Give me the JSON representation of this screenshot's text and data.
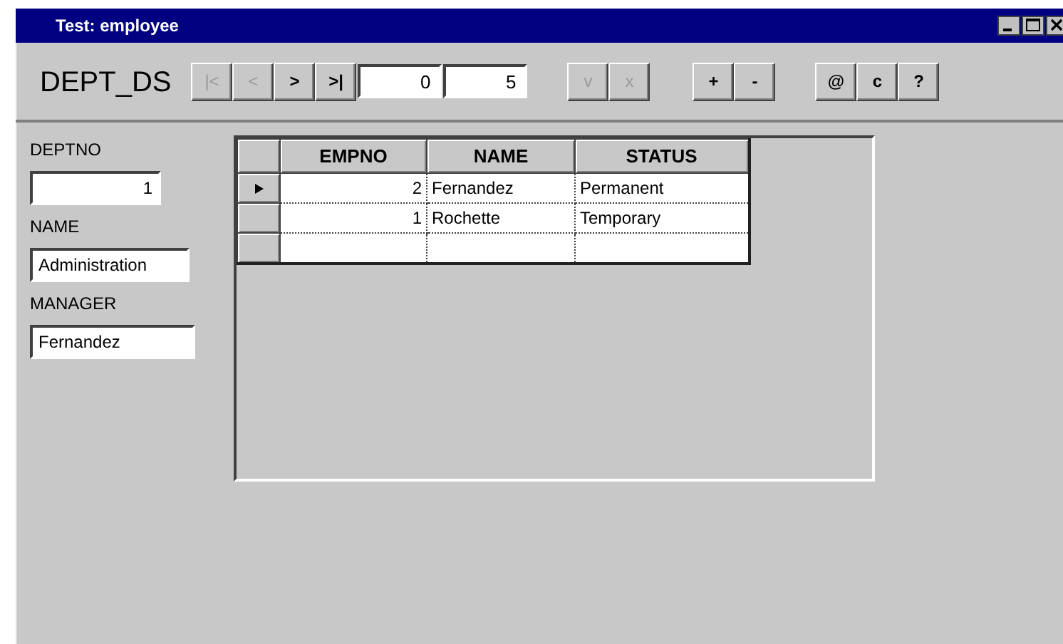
{
  "window": {
    "title": "Test: employee"
  },
  "toolbar": {
    "dataset": "DEPT_DS",
    "nav_buttons": [
      {
        "label": "|<",
        "disabled": true
      },
      {
        "label": "<",
        "disabled": true
      },
      {
        "label": ">",
        "disabled": false
      },
      {
        "label": ">|",
        "disabled": false
      }
    ],
    "record_fields": [
      {
        "value": "0"
      },
      {
        "value": "5"
      }
    ],
    "button_groups": [
      [
        {
          "label": "v",
          "disabled": true
        },
        {
          "label": "x",
          "disabled": true
        }
      ],
      [
        {
          "label": "+",
          "disabled": false
        },
        {
          "label": "-",
          "disabled": false
        }
      ],
      [
        {
          "label": "@",
          "disabled": false
        },
        {
          "label": "c",
          "disabled": false
        },
        {
          "label": "?",
          "disabled": false
        }
      ]
    ]
  },
  "form_fields": [
    {
      "label": "DEPTNO",
      "value": "1",
      "kind": "number"
    },
    {
      "label": "NAME",
      "value": "Administration",
      "kind": "text"
    },
    {
      "label": "MANAGER",
      "value": "Fernandez",
      "kind": "text"
    }
  ],
  "table": {
    "columns": [
      {
        "title": "EMPNO",
        "kind": "number"
      },
      {
        "title": "NAME",
        "kind": "text"
      },
      {
        "title": "STATUS",
        "kind": "text"
      }
    ],
    "rows": [
      {
        "selected": true,
        "cells": [
          "2",
          "Fernandez",
          "Permanent"
        ]
      },
      {
        "selected": false,
        "cells": [
          "1",
          "Rochette",
          "Temporary"
        ]
      }
    ]
  }
}
